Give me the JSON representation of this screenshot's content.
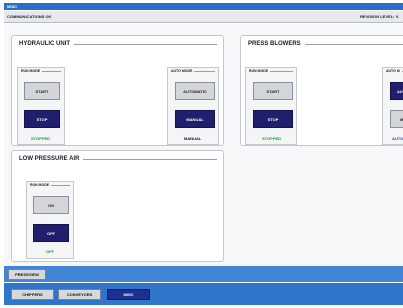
{
  "titlebar": {
    "title": "MISC"
  },
  "status": {
    "left": "COMMUNICATIONS OK",
    "right": "REVISION LEVEL: V."
  },
  "hydraulic": {
    "title": "HYDRAULIC UNIT",
    "run_mode": {
      "label": "RUN MODE",
      "start": "START",
      "stop": "STOP",
      "state": "STOPPED"
    },
    "auto_mode": {
      "label": "AUTO MODE",
      "automatic": "AUTOMATIC",
      "manual": "MANUAL",
      "state": "MANUAL"
    }
  },
  "press_blowers": {
    "title": "PRESS BLOWERS",
    "run_mode": {
      "label": "RUN MODE",
      "start": "START",
      "stop": "STOP",
      "state": "STOPPED"
    },
    "auto_mode": {
      "label": "AUTO M",
      "automatic": "AUTO",
      "manual": "MA",
      "state": "AUTO"
    }
  },
  "low_pressure_air": {
    "title": "LOW PRESSURE AIR",
    "run_mode": {
      "label": "RUN MODE",
      "on": "ON",
      "off": "OFF",
      "state": "OFF"
    }
  },
  "nav": {
    "pressview": "PRESSVIEW",
    "tabs": [
      "CHIPPERS",
      "CONVEYORS",
      "MISC"
    ],
    "active_tab": "MISC"
  },
  "colors": {
    "title_blue": "#2a70c8",
    "nav_blue": "#2f75cc",
    "button_dark": "#1f1f6e",
    "status_green": "#1c9a2b"
  }
}
